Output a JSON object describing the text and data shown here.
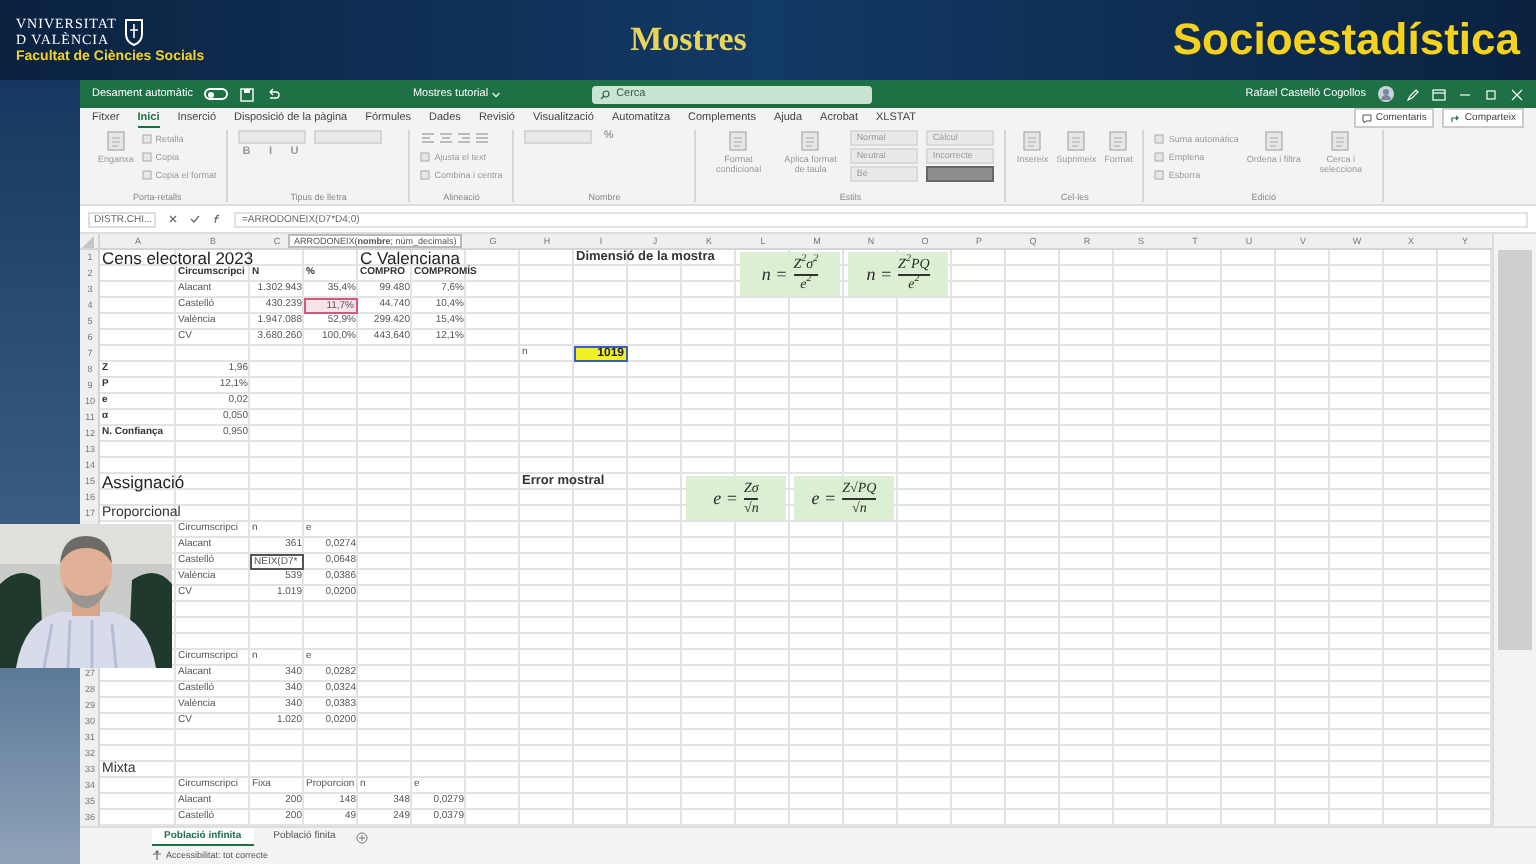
{
  "banner": {
    "logo_line1": "VNIVERSITAT",
    "logo_line2": "D VALÈNCIA",
    "faculty": "Facultat de Ciències Socials",
    "title": "Mostres",
    "brand": "Socioestadística"
  },
  "titlebar": {
    "autosave_label": "Desament automàtic",
    "autosave_on": false,
    "document": "Mostres tutorial",
    "search_placeholder": "Cerca",
    "user": "Rafael Castelló Cogollos"
  },
  "ribbon": {
    "tabs": [
      {
        "label": "Fitxer",
        "selected": false
      },
      {
        "label": "Inici",
        "selected": true
      },
      {
        "label": "Inserció",
        "selected": false
      },
      {
        "label": "Disposició de la pàgina",
        "selected": false
      },
      {
        "label": "Fórmules",
        "selected": false
      },
      {
        "label": "Dades",
        "selected": false
      },
      {
        "label": "Revisió",
        "selected": false
      },
      {
        "label": "Visualització",
        "selected": false
      },
      {
        "label": "Automatitza",
        "selected": false
      },
      {
        "label": "Complements",
        "selected": false
      },
      {
        "label": "Ajuda",
        "selected": false
      },
      {
        "label": "Acrobat",
        "selected": false
      },
      {
        "label": "XLSTAT",
        "selected": false
      }
    ],
    "actions": [
      {
        "kind": "comments",
        "label": "Comentaris"
      },
      {
        "kind": "share",
        "label": "Comparteix"
      }
    ],
    "groups": [
      {
        "label": "Porta-retalls",
        "items": [
          {
            "kind": "large",
            "text": "Enganxa"
          },
          {
            "kind": "small",
            "text": "Retalla"
          },
          {
            "kind": "small",
            "text": "Copia"
          },
          {
            "kind": "small",
            "text": "Copia el format"
          }
        ]
      },
      {
        "label": "Tipus de lletra",
        "items": [
          {
            "kind": "field"
          },
          {
            "kind": "field"
          },
          {
            "kind": "glyph",
            "text": "B"
          },
          {
            "kind": "glyph",
            "text": "I"
          },
          {
            "kind": "glyph",
            "text": "U"
          }
        ]
      },
      {
        "label": "Alineació",
        "items": [
          {
            "kind": "icons"
          },
          {
            "kind": "small",
            "text": "Ajusta el text"
          },
          {
            "kind": "small",
            "text": "Combina i centra"
          }
        ]
      },
      {
        "label": "Nombre",
        "items": [
          {
            "kind": "field"
          },
          {
            "kind": "glyph",
            "text": "%"
          }
        ]
      },
      {
        "label": "Estils",
        "items": [
          {
            "kind": "large",
            "text": "Format condicional"
          },
          {
            "kind": "large",
            "text": "Aplica format de taula"
          },
          {
            "kind": "style",
            "text": "Normal"
          },
          {
            "kind": "style",
            "text": "Neutral"
          },
          {
            "kind": "style",
            "text": "Bé"
          },
          {
            "kind": "style",
            "text": "Càlcul"
          },
          {
            "kind": "style",
            "text": "Incorrecte"
          },
          {
            "kind": "style-dark"
          }
        ]
      },
      {
        "label": "Cel·les",
        "items": [
          {
            "kind": "large",
            "text": "Insereix"
          },
          {
            "kind": "large",
            "text": "Suprimeix"
          },
          {
            "kind": "large",
            "text": "Format"
          }
        ]
      },
      {
        "label": "Edició",
        "items": [
          {
            "kind": "small",
            "text": "Suma automàtica"
          },
          {
            "kind": "small",
            "text": "Emplena"
          },
          {
            "kind": "small",
            "text": "Esborra"
          },
          {
            "kind": "large",
            "text": "Ordena i filtra"
          },
          {
            "kind": "large",
            "text": "Cerca i selecciona"
          }
        ]
      }
    ]
  },
  "formula_bar": {
    "name_box": "DISTR.CHI...",
    "formula": "=ARRODONEIX(D7*D4;0)",
    "tooltip": "ARRODONEIX(**nombre**; núm_decimals)"
  },
  "sheet": {
    "columns": [
      {
        "letter": "A"
      },
      {
        "letter": "B"
      },
      {
        "letter": "C"
      },
      {},
      {},
      {},
      {
        "letter": "G"
      },
      {
        "letter": "H"
      },
      {
        "letter": "I"
      },
      {
        "letter": "J"
      },
      {
        "letter": "K"
      },
      {
        "letter": "L"
      },
      {
        "letter": "M"
      },
      {
        "letter": "N"
      },
      {
        "letter": "O"
      },
      {
        "letter": "P"
      },
      {
        "letter": "Q"
      },
      {
        "letter": "R"
      },
      {
        "letter": "S"
      },
      {
        "letter": "T"
      },
      {
        "letter": "U"
      },
      {
        "letter": "V"
      },
      {
        "letter": "W"
      },
      {
        "letter": "X"
      },
      {
        "letter": "Y"
      }
    ],
    "rows": [
      {
        "number": "1",
        "cells": {
          "a": {
            "kind": "title",
            "text": "Cens electoral 2023"
          },
          "e": {
            "kind": "title",
            "text": "C Valenciana"
          },
          "i": {
            "kind": "heading",
            "text": "Dimensió de la mostra"
          },
          "l": {
            "kind": "formula",
            "lhs": "n =",
            "numerator": "Z$^{2}$σ$^{2}$",
            "denominator": "e$^{2}$"
          },
          "n": {
            "kind": "formula",
            "lhs": "n =",
            "numerator": "Z$^{2}$PQ",
            "denominator": "e$^{2}$"
          }
        }
      },
      {
        "number": "2",
        "cells": {
          "b": {
            "kind": "header",
            "text": "Circumscripci"
          },
          "c": {
            "kind": "header",
            "text": "N"
          },
          "d": {
            "kind": "header",
            "text": "%"
          },
          "e": {
            "kind": "header",
            "text": "COMPRO"
          },
          "f": {
            "kind": "header",
            "text": "COMPROMÍS"
          }
        }
      },
      {
        "number": "3",
        "cells": {
          "b": {
            "kind": "text",
            "text": "Alacant"
          },
          "c": {
            "kind": "number",
            "text": "1.302.943"
          },
          "d": {
            "kind": "number",
            "text": "35,4%"
          },
          "e": {
            "kind": "number",
            "text": "99.480"
          },
          "f": {
            "kind": "number",
            "text": "7,6%"
          }
        }
      },
      {
        "number": "4",
        "cells": {
          "b": {
            "kind": "text",
            "text": "Castelló"
          },
          "c": {
            "kind": "number",
            "text": "430.239"
          },
          "d": {
            "kind": "ref",
            "text": "11,7%"
          },
          "e": {
            "kind": "number",
            "text": "44.740"
          },
          "f": {
            "kind": "number",
            "text": "10,4%"
          }
        }
      },
      {
        "number": "5",
        "cells": {
          "b": {
            "kind": "text",
            "text": "València"
          },
          "c": {
            "kind": "number",
            "text": "1.947.088"
          },
          "d": {
            "kind": "number",
            "text": "52,9%"
          },
          "e": {
            "kind": "number",
            "text": "299.420"
          },
          "f": {
            "kind": "number",
            "text": "15,4%"
          }
        }
      },
      {
        "number": "6",
        "cells": {
          "b": {
            "kind": "text",
            "text": "CV"
          },
          "c": {
            "kind": "number",
            "text": "3.680.260"
          },
          "d": {
            "kind": "number",
            "text": "100,0%"
          },
          "e": {
            "kind": "number",
            "text": "443.640"
          },
          "f": {
            "kind": "number",
            "text": "12,1%"
          }
        }
      },
      {
        "number": "7",
        "cells": {
          "h": {
            "kind": "text",
            "text": "n"
          },
          "i": {
            "kind": "highlight",
            "text": "1019"
          }
        }
      },
      {
        "number": "8",
        "cells": {
          "a": {
            "kind": "bold",
            "text": "Z"
          },
          "b": {
            "kind": "number",
            "text": "1,96"
          }
        }
      },
      {
        "number": "9",
        "cells": {
          "a": {
            "kind": "bold",
            "text": "P"
          },
          "b": {
            "kind": "number",
            "text": "12,1%"
          }
        }
      },
      {
        "number": "10",
        "cells": {
          "a": {
            "kind": "bold",
            "text": "e"
          },
          "b": {
            "kind": "number",
            "text": "0,02"
          }
        }
      },
      {
        "number": "11",
        "cells": {
          "a": {
            "kind": "bold",
            "text": "α"
          },
          "b": {
            "kind": "number",
            "text": "0,050"
          }
        }
      },
      {
        "number": "12",
        "cells": {
          "a": {
            "kind": "bold",
            "text": "N. Confiança"
          },
          "b": {
            "kind": "number",
            "text": "0,950"
          }
        }
      },
      {
        "number": "13"
      },
      {
        "number": "14"
      },
      {
        "number": "15",
        "cells": {
          "a": {
            "kind": "title",
            "text": "Assignació"
          },
          "h": {
            "kind": "heading",
            "text": "Error mostral"
          },
          "k": {
            "kind": "formula",
            "lhs": "e =",
            "numerator": "Zσ",
            "denominator": "√n"
          },
          "m": {
            "kind": "formula",
            "lhs": "e =",
            "numerator": "Z√PQ",
            "denominator": "√n"
          }
        }
      },
      {
        "number": "16"
      },
      {
        "number": "17",
        "cells": {
          "a": {
            "kind": "subtitle",
            "text": "Proporcional"
          }
        }
      },
      {
        "cells": {
          "b": {
            "kind": "text",
            "text": "Circumscripci"
          },
          "c": {
            "kind": "text",
            "text": "n"
          },
          "d": {
            "kind": "text",
            "text": "e"
          }
        }
      },
      {
        "cells": {
          "b": {
            "kind": "text",
            "text": "Alacant"
          },
          "c": {
            "kind": "number",
            "text": "361"
          },
          "d": {
            "kind": "number",
            "text": "0,0274"
          }
        }
      },
      {
        "cells": {
          "b": {
            "kind": "text",
            "text": "Castelló"
          },
          "c": {
            "kind": "edit",
            "text": "NEIX(D7*"
          },
          "d": {
            "kind": "number",
            "text": "0,0648"
          }
        }
      },
      {
        "cells": {
          "b": {
            "kind": "text",
            "text": "València"
          },
          "c": {
            "kind": "number",
            "text": "539"
          },
          "d": {
            "kind": "number",
            "text": "0,0386"
          }
        }
      },
      {
        "cells": {
          "b": {
            "kind": "text",
            "text": "CV"
          },
          "c": {
            "kind": "number",
            "text": "1.019"
          },
          "d": {
            "kind": "number",
            "text": "0,0200"
          }
        }
      },
      {},
      {},
      {},
      {
        "cells": {
          "b": {
            "kind": "text",
            "text": "Circumscripci"
          },
          "c": {
            "kind": "text",
            "text": "n"
          },
          "d": {
            "kind": "text",
            "text": "e"
          }
        }
      },
      {
        "number": "27",
        "cells": {
          "b": {
            "kind": "text",
            "text": "Alacant"
          },
          "c": {
            "kind": "number",
            "text": "340"
          },
          "d": {
            "kind": "number",
            "text": "0,0282"
          }
        }
      },
      {
        "number": "28",
        "cells": {
          "b": {
            "kind": "text",
            "text": "Castelló"
          },
          "c": {
            "kind": "number",
            "text": "340"
          },
          "d": {
            "kind": "number",
            "text": "0,0324"
          }
        }
      },
      {
        "number": "29",
        "cells": {
          "b": {
            "kind": "text",
            "text": "València"
          },
          "c": {
            "kind": "number",
            "text": "340"
          },
          "d": {
            "kind": "number",
            "text": "0,0383"
          }
        }
      },
      {
        "number": "30",
        "cells": {
          "b": {
            "kind": "text",
            "text": "CV"
          },
          "c": {
            "kind": "number",
            "text": "1.020"
          },
          "d": {
            "kind": "number",
            "text": "0,0200"
          }
        }
      },
      {
        "number": "31"
      },
      {
        "number": "32"
      },
      {
        "number": "33",
        "cells": {
          "a": {
            "kind": "subtitle",
            "text": "Mixta"
          }
        }
      },
      {
        "number": "34",
        "cells": {
          "b": {
            "kind": "text",
            "text": "Circumscripci"
          },
          "c": {
            "kind": "text",
            "text": "Fixa"
          },
          "d": {
            "kind": "text",
            "text": "Proporcion"
          },
          "e": {
            "kind": "text",
            "text": "n"
          },
          "f": {
            "kind": "text",
            "text": "e"
          }
        }
      },
      {
        "number": "35",
        "cells": {
          "b": {
            "kind": "text",
            "text": "Alacant"
          },
          "c": {
            "kind": "number",
            "text": "200"
          },
          "d": {
            "kind": "number",
            "text": "148"
          },
          "e": {
            "kind": "number",
            "text": "348"
          },
          "f": {
            "kind": "number",
            "text": "0,0279"
          }
        }
      },
      {
        "number": "36",
        "cells": {
          "b": {
            "kind": "text",
            "text": "Castelló"
          },
          "c": {
            "kind": "number",
            "text": "200"
          },
          "d": {
            "kind": "number",
            "text": "49"
          },
          "e": {
            "kind": "number",
            "text": "249"
          },
          "f": {
            "kind": "number",
            "text": "0,0379"
          }
        }
      }
    ]
  },
  "sheet_tabs": [
    {
      "label": "Població infinita",
      "selected": true
    },
    {
      "label": "Població finita",
      "selected": false
    }
  ],
  "status_bar": {
    "accessibility": "Accessibilitat: tot correcte"
  }
}
